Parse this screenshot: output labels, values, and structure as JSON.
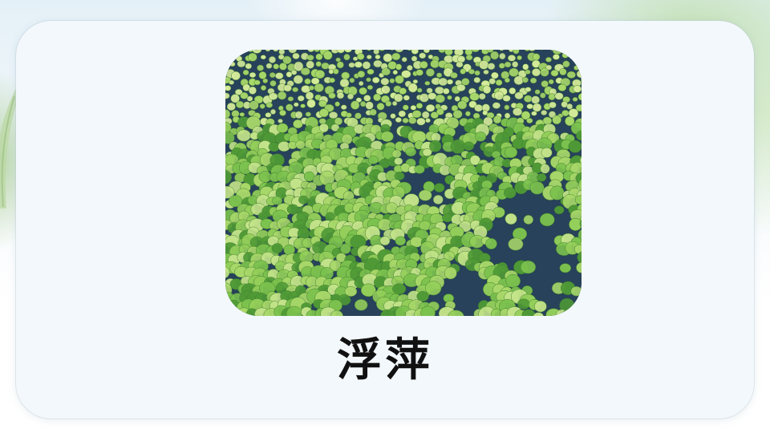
{
  "slide": {
    "caption": "浮萍",
    "image_subject": "duckweed-photo"
  },
  "colors": {
    "card_background": "#f3f8fc",
    "water": "#27425a",
    "leaf_light": "#a9d86a",
    "leaf_mid": "#7cc24e",
    "leaf_dark": "#4f9a36",
    "caption_text": "#111111"
  }
}
